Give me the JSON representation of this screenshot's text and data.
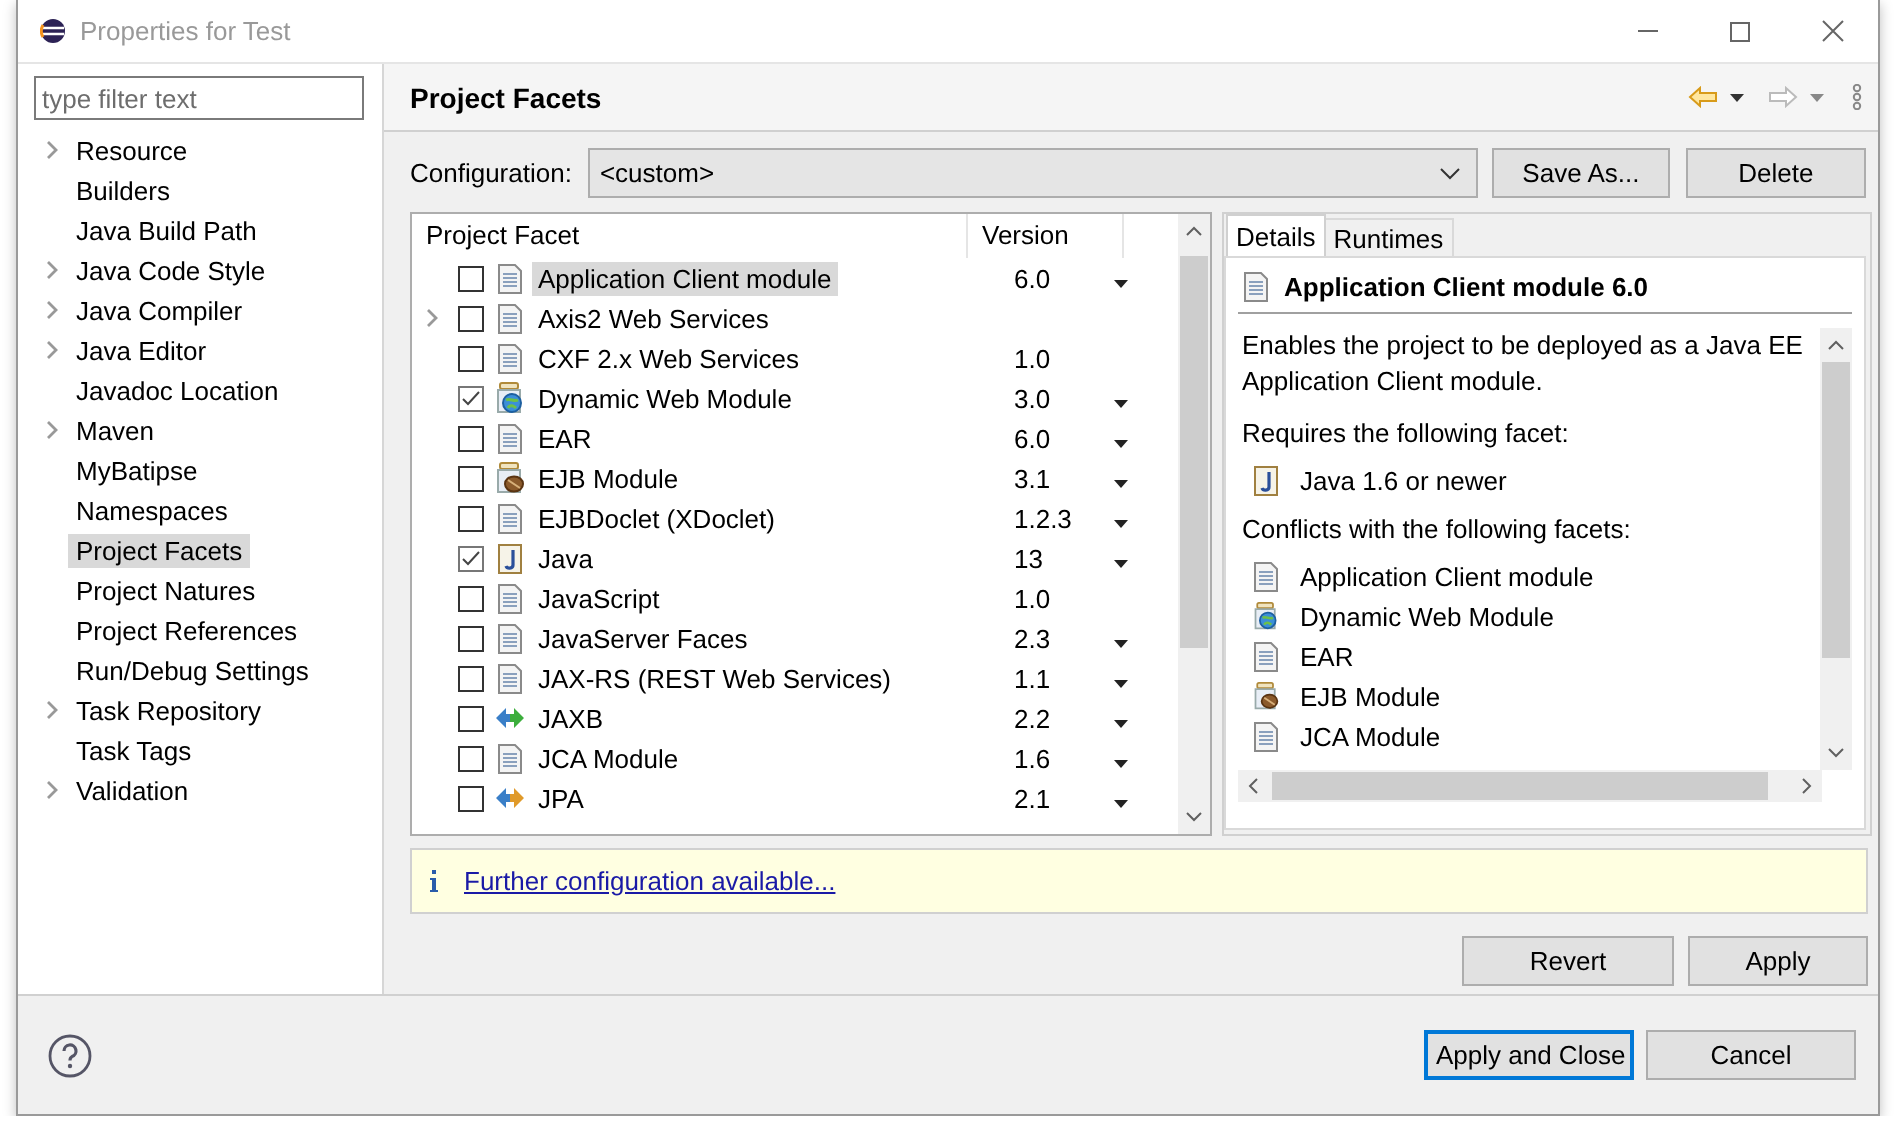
{
  "window": {
    "title": "Properties for Test"
  },
  "sidebar": {
    "filter": {
      "placeholder": "type filter text"
    },
    "items": [
      {
        "label": "Resource",
        "expandable": true,
        "selected": false
      },
      {
        "label": "Builders",
        "expandable": false,
        "selected": false
      },
      {
        "label": "Java Build Path",
        "expandable": false,
        "selected": false
      },
      {
        "label": "Java Code Style",
        "expandable": true,
        "selected": false
      },
      {
        "label": "Java Compiler",
        "expandable": true,
        "selected": false
      },
      {
        "label": "Java Editor",
        "expandable": true,
        "selected": false
      },
      {
        "label": "Javadoc Location",
        "expandable": false,
        "selected": false
      },
      {
        "label": "Maven",
        "expandable": true,
        "selected": false
      },
      {
        "label": "MyBatipse",
        "expandable": false,
        "selected": false
      },
      {
        "label": "Namespaces",
        "expandable": false,
        "selected": false
      },
      {
        "label": "Project Facets",
        "expandable": false,
        "selected": true
      },
      {
        "label": "Project Natures",
        "expandable": false,
        "selected": false
      },
      {
        "label": "Project References",
        "expandable": false,
        "selected": false
      },
      {
        "label": "Run/Debug Settings",
        "expandable": false,
        "selected": false
      },
      {
        "label": "Task Repository",
        "expandable": true,
        "selected": false
      },
      {
        "label": "Task Tags",
        "expandable": false,
        "selected": false
      },
      {
        "label": "Validation",
        "expandable": true,
        "selected": false
      }
    ]
  },
  "page": {
    "title": "Project Facets"
  },
  "configuration": {
    "label": "Configuration:",
    "value": "<custom>",
    "buttons": [
      "Save As...",
      "Delete"
    ]
  },
  "facets": {
    "columns": [
      "Project Facet",
      "Version"
    ],
    "rows": [
      {
        "name": "Application Client module",
        "version": "6.0",
        "kind": "document",
        "checked": false,
        "expandable": false,
        "has_versions": true,
        "selected": true
      },
      {
        "name": "Axis2 Web Services",
        "version": "",
        "kind": "document",
        "checked": false,
        "expandable": true,
        "has_versions": false,
        "selected": false
      },
      {
        "name": "CXF 2.x Web Services",
        "version": "1.0",
        "kind": "document",
        "checked": false,
        "expandable": false,
        "has_versions": false,
        "selected": false
      },
      {
        "name": "Dynamic Web Module",
        "version": "3.0",
        "kind": "web",
        "checked": true,
        "expandable": false,
        "has_versions": true,
        "selected": false
      },
      {
        "name": "EAR",
        "version": "6.0",
        "kind": "document",
        "checked": false,
        "expandable": false,
        "has_versions": true,
        "selected": false
      },
      {
        "name": "EJB Module",
        "version": "3.1",
        "kind": "ejb",
        "checked": false,
        "expandable": false,
        "has_versions": true,
        "selected": false
      },
      {
        "name": "EJBDoclet (XDoclet)",
        "version": "1.2.3",
        "kind": "document",
        "checked": false,
        "expandable": false,
        "has_versions": true,
        "selected": false
      },
      {
        "name": "Java",
        "version": "13",
        "kind": "java",
        "checked": true,
        "expandable": false,
        "has_versions": true,
        "selected": false
      },
      {
        "name": "JavaScript",
        "version": "1.0",
        "kind": "document",
        "checked": false,
        "expandable": false,
        "has_versions": false,
        "selected": false
      },
      {
        "name": "JavaServer Faces",
        "version": "2.3",
        "kind": "document",
        "checked": false,
        "expandable": false,
        "has_versions": true,
        "selected": false
      },
      {
        "name": "JAX-RS (REST Web Services)",
        "version": "1.1",
        "kind": "document",
        "checked": false,
        "expandable": false,
        "has_versions": true,
        "selected": false
      },
      {
        "name": "JAXB",
        "version": "2.2",
        "kind": "binding",
        "checked": false,
        "expandable": false,
        "has_versions": true,
        "selected": false
      },
      {
        "name": "JCA Module",
        "version": "1.6",
        "kind": "document",
        "checked": false,
        "expandable": false,
        "has_versions": true,
        "selected": false
      },
      {
        "name": "JPA",
        "version": "2.1",
        "kind": "persistence",
        "checked": false,
        "expandable": false,
        "has_versions": true,
        "selected": false
      }
    ]
  },
  "details": {
    "tabs": [
      {
        "label": "Details",
        "selected": true
      },
      {
        "label": "Runtimes",
        "selected": false
      }
    ],
    "header": {
      "title": "Application Client module 6.0",
      "kind": "document"
    },
    "description": "Enables the project to be deployed as a Java EE Application Client module.",
    "requires_heading": "Requires the following facet:",
    "requires": [
      {
        "name": "Java 1.6 or newer",
        "kind": "java"
      }
    ],
    "conflicts_heading": "Conflicts with the following facets:",
    "conflicts": [
      {
        "name": "Application Client module",
        "kind": "document"
      },
      {
        "name": "Dynamic Web Module",
        "kind": "web"
      },
      {
        "name": "EAR",
        "kind": "document"
      },
      {
        "name": "EJB Module",
        "kind": "ejb"
      },
      {
        "name": "JCA Module",
        "kind": "document"
      }
    ]
  },
  "info": {
    "link": "Further configuration available..."
  },
  "page_buttons": [
    "Revert",
    "Apply"
  ],
  "dialog_buttons": [
    {
      "label": "Apply and Close",
      "default": true
    },
    {
      "label": "Cancel",
      "default": false
    }
  ]
}
